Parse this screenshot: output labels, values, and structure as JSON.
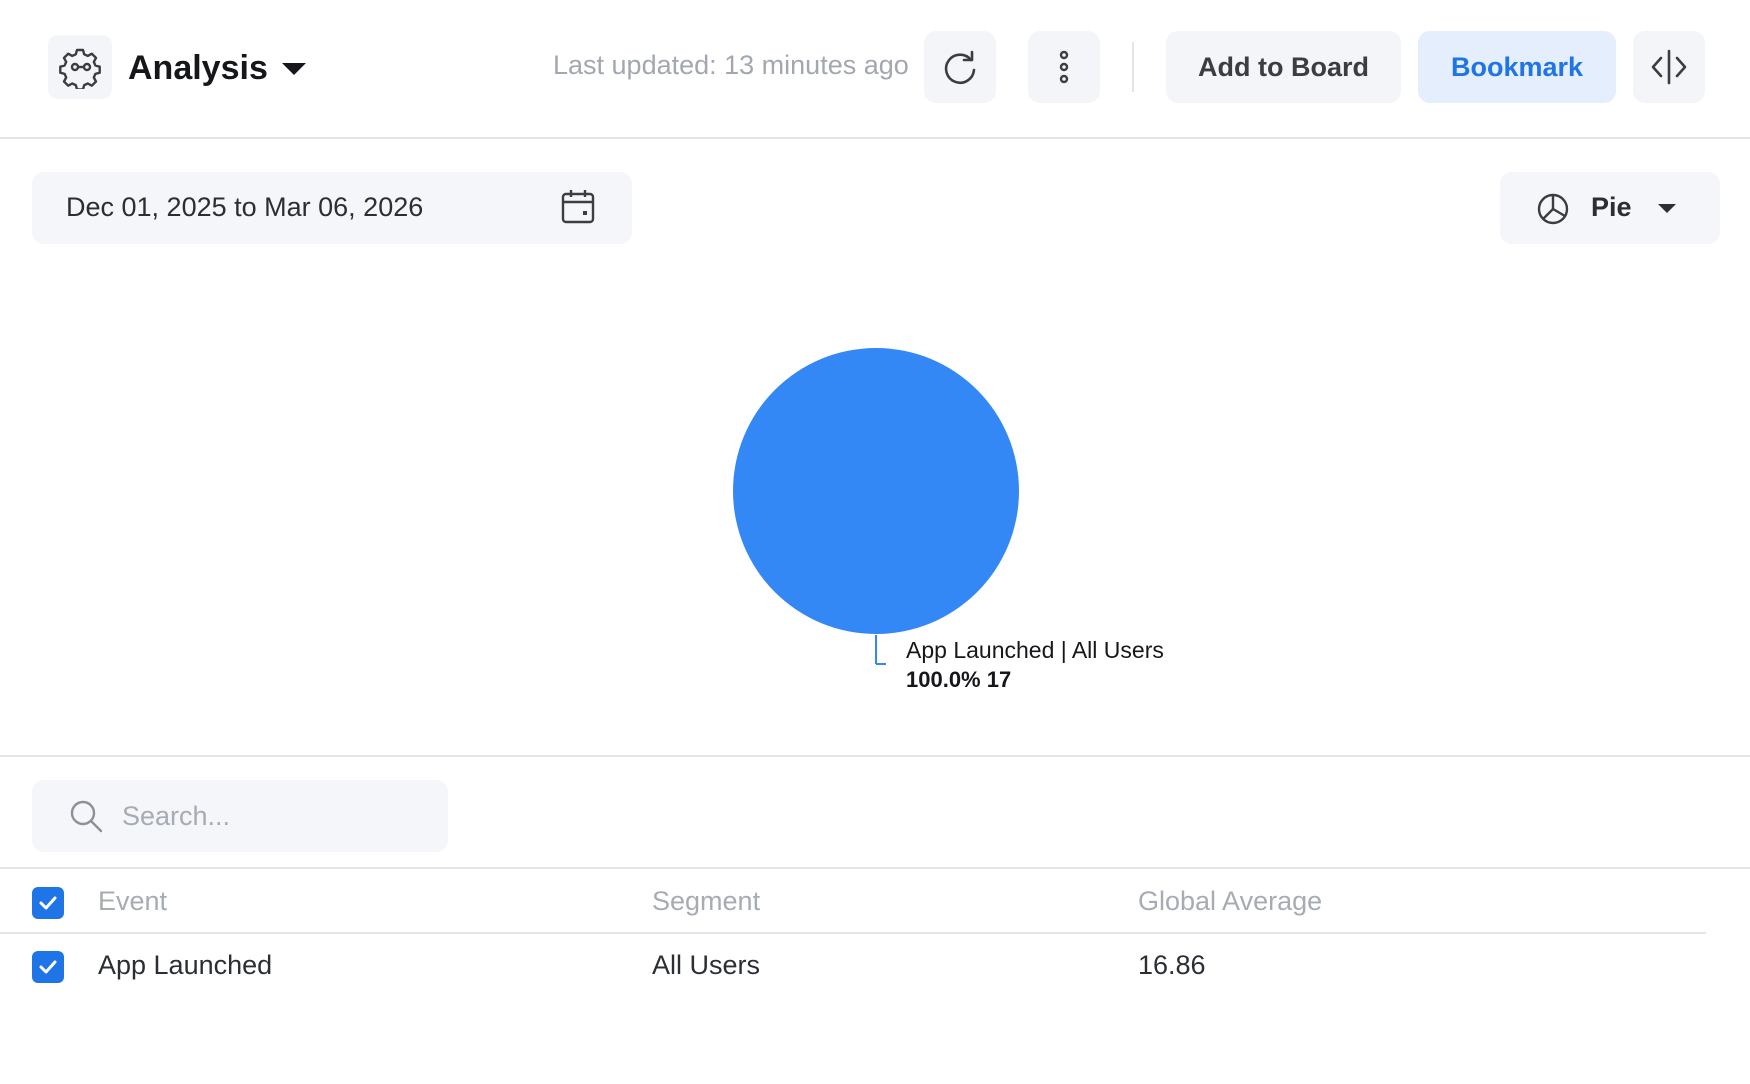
{
  "header": {
    "title": "Analysis",
    "last_updated": "Last updated: 13 minutes ago",
    "add_to_board_label": "Add to Board",
    "bookmark_label": "Bookmark",
    "icons": [
      "settings-flow-icon",
      "chevron-down-icon",
      "refresh-icon",
      "more-vertical-icon",
      "code-split-icon"
    ]
  },
  "controls": {
    "date_range": "Dec 01, 2025 to Mar 06, 2026",
    "chart_type_label": "Pie"
  },
  "chart_data": {
    "type": "pie",
    "slices": [
      {
        "label": "App Launched | All Users",
        "percent": 100.0,
        "value": 17,
        "color": "#3388f5"
      }
    ],
    "annotation_label": "App Launched | All Users",
    "annotation_value": "100.0% 17"
  },
  "search": {
    "placeholder": "Search..."
  },
  "table": {
    "columns": [
      "Event",
      "Segment",
      "Global Average"
    ],
    "rows": [
      {
        "event": "App Launched",
        "segment": "All Users",
        "global_average": "16.86",
        "checked": true
      }
    ]
  },
  "colors": {
    "accent": "#1f74e6",
    "pie": "#3388f5",
    "bookmark_bg": "#e4eefc"
  }
}
